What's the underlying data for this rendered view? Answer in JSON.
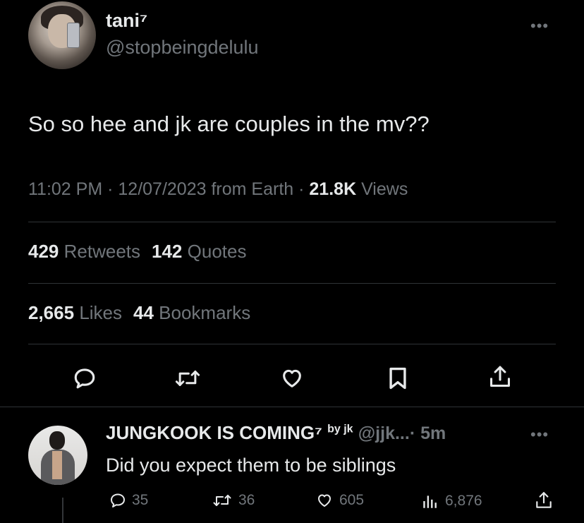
{
  "tweet": {
    "author_name": "tani⁷",
    "author_handle": "@stopbeingdelulu",
    "more_label": "•••",
    "text": "So so hee and jk are couples in the mv??",
    "time": "11:02 PM",
    "date": "12/07/2023",
    "source": "from Earth",
    "views_count": "21.8K",
    "views_label": "Views",
    "sep": "·"
  },
  "stats": {
    "retweets_count": "429",
    "retweets_label": "Retweets",
    "quotes_count": "142",
    "quotes_label": "Quotes",
    "likes_count": "2,665",
    "likes_label": "Likes",
    "bookmarks_count": "44",
    "bookmarks_label": "Bookmarks"
  },
  "actions": [
    "reply-icon",
    "retweet-icon",
    "like-icon",
    "bookmark-icon",
    "share-icon"
  ],
  "reply": {
    "author_name": "JUNGKOOK IS COMING⁷",
    "author_suffix": "by jk",
    "author_handle": "@jjk...",
    "time": "· 5m",
    "more_label": "•••",
    "text": "Did you expect them to be siblings",
    "replies": "35",
    "retweets": "36",
    "likes": "605",
    "views": "6,876"
  },
  "colors": {
    "background": "#000000",
    "text": "#e7e9ea",
    "secondary": "#71767b",
    "divider": "#2f3336"
  }
}
